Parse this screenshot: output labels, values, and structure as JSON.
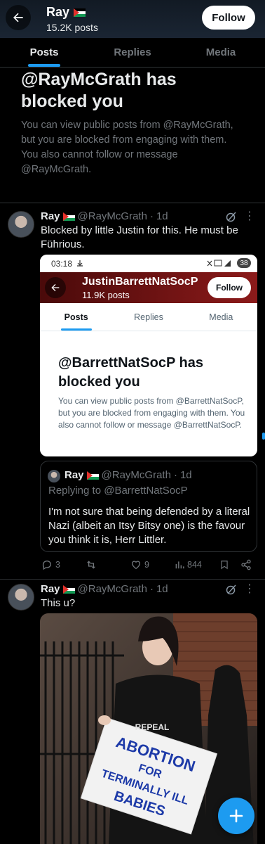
{
  "header": {
    "name": "Ray",
    "posts": "15.2K posts",
    "follow": "Follow"
  },
  "tabs": [
    {
      "label": "Posts"
    },
    {
      "label": "Replies"
    },
    {
      "label": "Media"
    }
  ],
  "blocked": {
    "title": "@RayMcGrath has blocked you",
    "description": "You can view public posts from @RayMcGrath, but you are blocked from engaging with them. You also cannot follow or message @RayMcGrath."
  },
  "tweet1": {
    "name": "Ray",
    "handle": "@RayMcGrath",
    "sep": "·",
    "time": "1d",
    "text": "Blocked by little Justin for this. He must be Führious.",
    "screenshot": {
      "time": "03:18",
      "battery": "38",
      "name": "JustinBarrettNatSocP",
      "posts": "11.9K posts",
      "follow": "Follow",
      "tabs": [
        "Posts",
        "Replies",
        "Media"
      ],
      "title": "@BarrettNatSocP has blocked you",
      "description": "You can view public posts from @BarrettNatSocP, but you are blocked from engaging with them. You also cannot follow or message @BarrettNatSocP."
    },
    "quote": {
      "name": "Ray",
      "handle": "@RayMcGrath",
      "sep": "·",
      "time": "1d",
      "replying": "Replying to @BarrettNatSocP",
      "text": "I'm not sure that being defended by a literal Nazi (albeit an Itsy Bitsy one) is the favour you think it is, Herr Littler."
    },
    "stats": {
      "replies": "3",
      "retweets": "",
      "likes": "9",
      "views": "844"
    }
  },
  "tweet2": {
    "name": "Ray",
    "handle": "@RayMcGrath",
    "sep": "·",
    "time": "1d",
    "text": "This u?",
    "image": {
      "sign_lines": [
        "ABORTION",
        "FOR",
        "TERMINALLY ILL",
        "BABIES"
      ],
      "shirt_text": "REPEAL"
    }
  },
  "colors": {
    "accent": "#1d9bf0",
    "text_secondary": "#71767b",
    "background": "#000000"
  }
}
